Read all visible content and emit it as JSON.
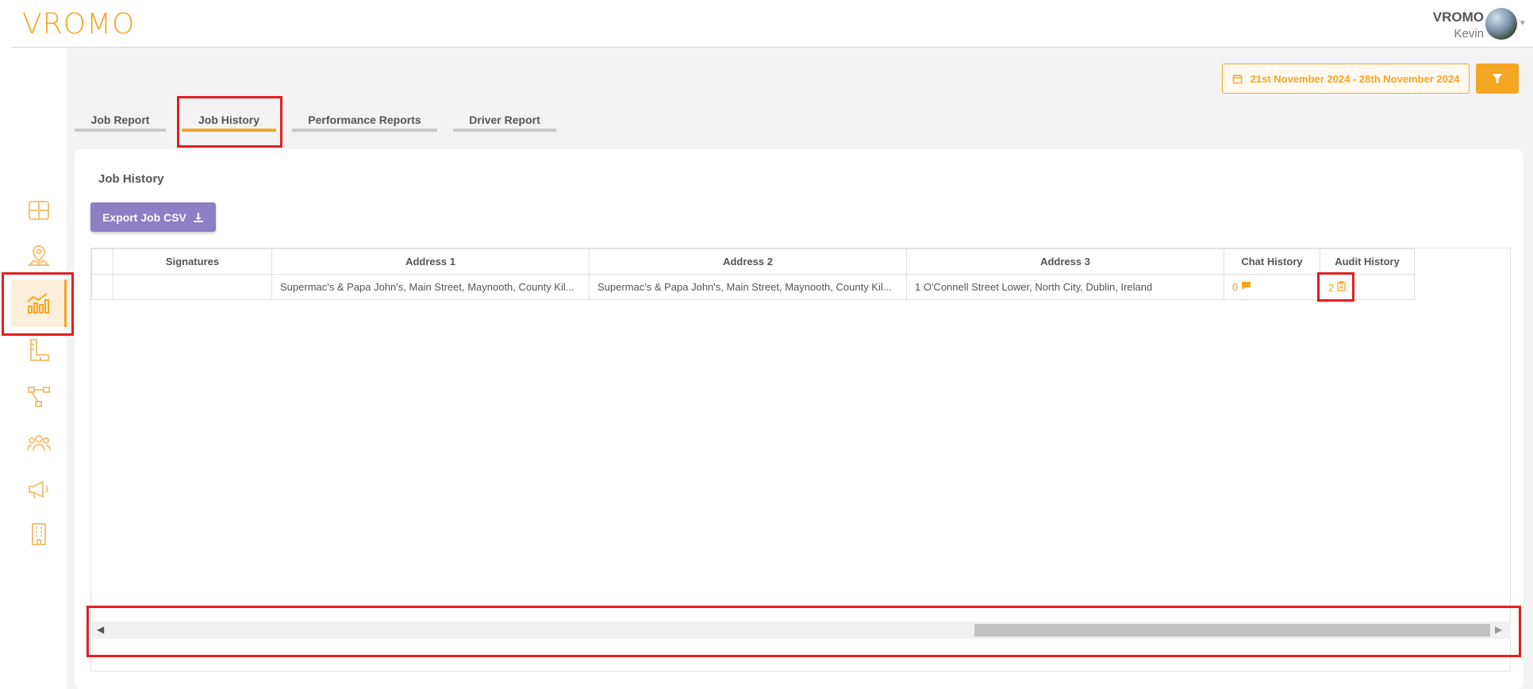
{
  "app": {
    "logo": "VROMO",
    "user_company": "VROMO",
    "user_name": "Kevin"
  },
  "header": {
    "date_range": "21st November 2024 - 28th November 2024",
    "filter_icon": "filter-icon"
  },
  "sidebar": {
    "items": [
      {
        "icon": "dashboard-icon"
      },
      {
        "icon": "map-icon"
      },
      {
        "icon": "analytics-icon",
        "active": true
      },
      {
        "icon": "ruler-icon"
      },
      {
        "icon": "workflow-icon"
      },
      {
        "icon": "users-icon"
      },
      {
        "icon": "megaphone-icon"
      },
      {
        "icon": "building-icon"
      }
    ]
  },
  "tabs": [
    {
      "label": "Job Report"
    },
    {
      "label": "Job History",
      "active": true
    },
    {
      "label": "Performance Reports"
    },
    {
      "label": "Driver Report"
    }
  ],
  "card": {
    "title": "Job History",
    "export_label": "Export Job CSV"
  },
  "table": {
    "columns": [
      "",
      "Signatures",
      "Address 1",
      "Address 2",
      "Address 3",
      "Chat History",
      "Audit History"
    ],
    "rows": [
      {
        "signatures": "",
        "address1": "Supermac's & Papa John's, Main Street, Maynooth, County Kil...",
        "address2": "Supermac's & Papa John's, Main Street, Maynooth, County Kil...",
        "address3": "1 O'Connell Street Lower, North City, Dublin, Ireland",
        "chat_count": "0",
        "audit_count": "2"
      }
    ]
  },
  "colors": {
    "accent": "#f5a623",
    "export_button": "#8d7ec6",
    "highlight": "#e02020"
  }
}
